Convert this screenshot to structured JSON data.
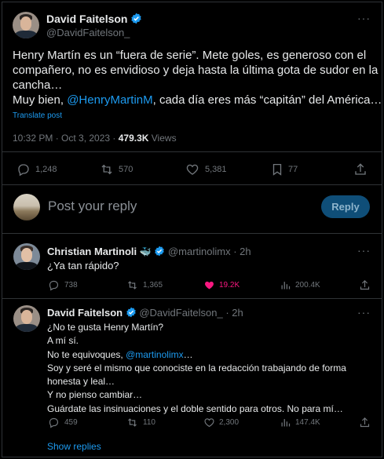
{
  "main_tweet": {
    "author_name": "David Faitelson",
    "author_handle": "@DavidFaitelson_",
    "text_lines": [
      "Henry Martín es un “fuera de serie”. Mete goles, es generoso con el",
      "compañero, no es envidioso y deja hasta la última gota de sudor en la",
      "cancha…"
    ],
    "text_last_prefix": "Muy bien, ",
    "text_last_mention": "@HenryMartinM",
    "text_last_suffix": ", cada día eres más “capitán” del América…",
    "translate": "Translate post",
    "timestamp": "10:32 PM · Oct 3, 2023 · ",
    "views_count": "479.3K",
    "views_label": " Views",
    "replies": "1,248",
    "reposts": "570",
    "likes": "5,381",
    "bookmarks": "77"
  },
  "reply_composer": {
    "placeholder": "Post your reply",
    "button": "Reply"
  },
  "reply1": {
    "author_name": "Christian Martinoli",
    "author_emoji": "🐳",
    "author_handle": "@martinolimx",
    "time": " · 2h",
    "text": "¿Ya tan rápido?",
    "replies": "738",
    "reposts": "1,365",
    "likes": "19.2K",
    "views": "200.4K",
    "like_color": "#f91880"
  },
  "reply2": {
    "author_name": "David Faitelson",
    "author_handle": "@DavidFaitelson_",
    "time": " · 2h",
    "line1": "¿No te gusta Henry Martín?",
    "line2": "A mí sí.",
    "line3_prefix": "No te equivoques, ",
    "line3_mention": "@martinolimx",
    "line3_suffix": "…",
    "line4": "Soy y seré el mismo que conociste en la redacción trabajando de forma",
    "line5": "honesta y leal…",
    "line6": "Y no pienso cambiar…",
    "line7": "Guárdate las insinuaciones y el doble sentido para otros. No para mí…",
    "replies": "459",
    "reposts": "110",
    "likes": "2,300",
    "views": "147.4K"
  },
  "show_replies": "Show replies",
  "colors": {
    "accent": "#1d9bf0",
    "muted": "#71767b",
    "border": "#2f3336"
  }
}
